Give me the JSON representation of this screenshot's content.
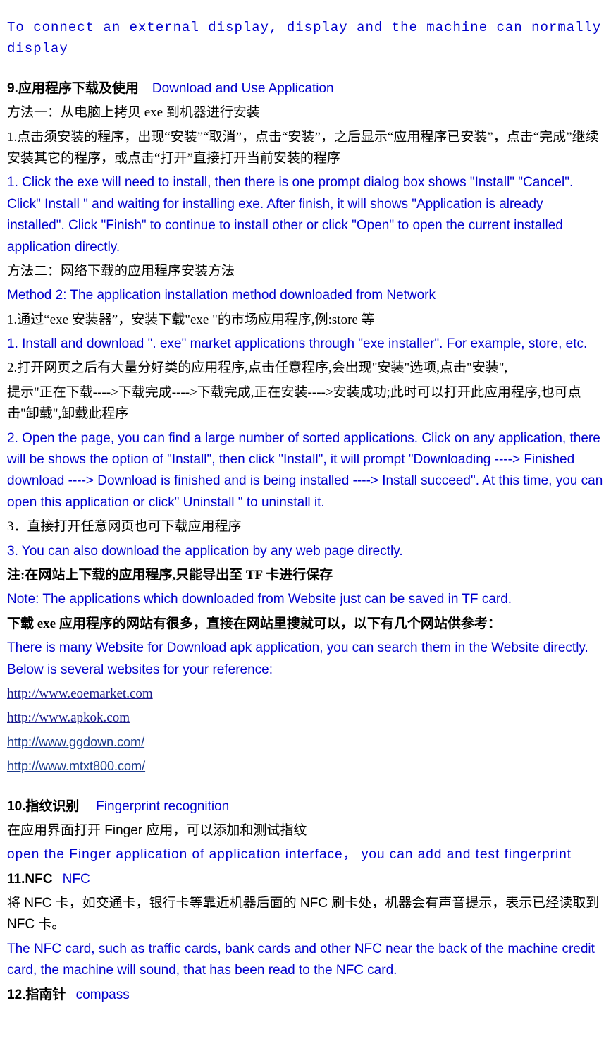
{
  "topline": "To connect an external display, display and the machine can normally display",
  "section9": {
    "heading_cn": "9.应用程序下载及使用",
    "heading_en": "Download and Use Application",
    "method1_cn": "方法一：从电脑上拷贝 exe 到机器进行安装",
    "method1_step1_cn": "1.点击须安装的程序，出现“安装”“取消”，点击“安装”，之后显示“应用程序已安装”，点击“完成”继续安装其它的程序，或点击“打开”直接打开当前安装的程序",
    "method1_step1_en": "1. Click the exe will need to install, then there is one prompt dialog box shows \"Install\" \"Cancel\". Click\" Install \" and waiting for installing exe. After finish, it will shows \"Application is already installed\". Click \"Finish\" to continue to install other or click \"Open\" to open the current installed application directly.",
    "method2_cn": "方法二：网络下载的应用程序安装方法",
    "method2_en": "Method 2: The application installation method downloaded from Network",
    "method2_step1_cn": "1.通过“exe 安装器”，安装下载\"exe \"的市场应用程序,例:store 等",
    "method2_step1_en": "1. Install and download \". exe\" market applications through \"exe installer\". For example, store, etc.",
    "method2_step2_cn": "2.打开网页之后有大量分好类的应用程序,点击任意程序,会出现\"安装\"选项,点击\"安装\",",
    "method2_step2_cn_line2": "提示\"正在下载---->下载完成---->下载完成,正在安装---->安装成功;此时可以打开此应用程序,也可点击\"卸载\",卸载此程序",
    "method2_step2_en": "2. Open the page, you can find a large number of sorted applications. Click on any application, there will be shows the option of \"Install\", then click \"Install\", it will prompt \"Downloading ----> Finished download ----> Download is finished and is being installed ----> Install succeed\". At this time, you can open this application or click\" Uninstall \" to uninstall it.",
    "method2_step3_cn": "3．直接打开任意网页也可下载应用程序",
    "method2_step3_en": "3. You can also download the application by any web page directly.",
    "note_cn": "注:在网站上下载的应用程序,只能导出至 TF 卡进行保存",
    "note_en": "Note: The applications which downloaded from Website just can be saved in TF card.",
    "sites_cn": "下载 exe 应用程序的网站有很多，直接在网站里搜就可以，以下有几个网站供参考：",
    "sites_en": "There is many Website for Download apk application, you can search them in the Website directly. Below is several websites for your reference:",
    "links": {
      "l1": "http://www.eoemarket.com",
      "l2": "http://www.apkok.com",
      "l3": "http://www.ggdown.com/",
      "l4": "http://www.mtxt800.com/"
    }
  },
  "section10": {
    "heading_cn": "10.指纹识别",
    "heading_en": "Fingerprint recognition",
    "body_cn": "在应用界面打开 Finger 应用，可以添加和测试指纹",
    "body_en": "open the Finger application of application interface， you can add and test fingerprint"
  },
  "section11": {
    "heading_cn": "11.NFC",
    "heading_en": "NFC",
    "body_cn": "将 NFC 卡，如交通卡，银行卡等靠近机器后面的 NFC 刷卡处，机器会有声音提示，表示已经读取到 NFC 卡。",
    "body_en": "The NFC card, such as traffic cards, bank cards and other NFC near the back of the machine credit card, the machine will sound, that has been read to the NFC card."
  },
  "section12": {
    "heading_cn": "12.指南针",
    "heading_en": "compass"
  }
}
